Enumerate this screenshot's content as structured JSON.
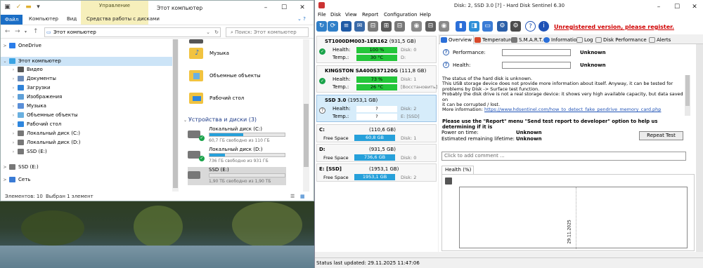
{
  "explorer": {
    "title": "Этот компьютер",
    "context_tab_top": "Управление",
    "ribbon_tabs": [
      "Файл",
      "Компьютер",
      "Вид",
      "Средства работы с дисками"
    ],
    "address": "Этот компьютер",
    "search_placeholder": "Поиск: Этот компьютер",
    "nav_items": [
      {
        "label": "OneDrive",
        "icon": "cloud-icon",
        "color": "#2b7de9"
      },
      {
        "label": "Этот компьютер",
        "icon": "computer-icon",
        "color": "#3aa3e3"
      },
      {
        "label": "Видео",
        "icon": "video-folder-icon",
        "color": "#555"
      },
      {
        "label": "Документы",
        "icon": "documents-folder-icon",
        "color": "#6b8bb8"
      },
      {
        "label": "Загрузки",
        "icon": "downloads-folder-icon",
        "color": "#2f82d8"
      },
      {
        "label": "Изображения",
        "icon": "pictures-folder-icon",
        "color": "#5fa0d8"
      },
      {
        "label": "Музыка",
        "icon": "music-folder-icon",
        "color": "#5a8fd8"
      },
      {
        "label": "Объемные объекты",
        "icon": "3d-objects-icon",
        "color": "#6ab0e0"
      },
      {
        "label": "Рабочий стол",
        "icon": "desktop-folder-icon",
        "color": "#2e86de"
      },
      {
        "label": "Локальный диск (C:)",
        "icon": "drive-icon",
        "color": "#777"
      },
      {
        "label": "Локальный диск (D:)",
        "icon": "drive-icon",
        "color": "#777"
      },
      {
        "label": "SSD (E:)",
        "icon": "drive-icon",
        "color": "#777"
      },
      {
        "label": "SSD (E:)",
        "icon": "drive-icon",
        "color": "#777"
      },
      {
        "label": "Сеть",
        "icon": "network-icon",
        "color": "#3a7bd5"
      }
    ],
    "folders": [
      "Музыка",
      "Объемные объекты",
      "Рабочий стол"
    ],
    "devices_header": "Устройства и диски (3)",
    "drives": [
      {
        "name": "Локальный диск (C:)",
        "free": "60,7 ГБ свободно из 110 ГБ",
        "used": 0.45
      },
      {
        "name": "Локальный диск (D:)",
        "free": "736 ГБ свободно из 931 ГБ",
        "used": 0.21
      },
      {
        "name": "SSD (E:)",
        "free": "1,90 ТБ свободно из 1,90 ТБ",
        "used": 0.0
      }
    ],
    "status": {
      "count": "Элементов: 10",
      "selected": "Выбран 1 элемент"
    }
  },
  "hds": {
    "title": "Disk: 2, SSD 3.0 [?]  -  Hard Disk Sentinel 6.30",
    "menu": [
      "File",
      "Disk",
      "View",
      "Report",
      "Configuration",
      "Help"
    ],
    "unregistered": "Unregistered version, please register.",
    "disks": [
      {
        "name": "ST1000DM003-1ER162",
        "size": "(931,5 GB)",
        "health": "100 %",
        "health_note": "Disk: 0",
        "temp": "30 °C",
        "temp_note": "D:",
        "color": "#24c63a",
        "status": "ok"
      },
      {
        "name": "KINGSTON SA400S37120G",
        "size": "(111,8 GB)",
        "health": "73 %",
        "health_note": "Disk: 1",
        "temp": "26 °C",
        "temp_note": "[Восстановить]",
        "color": "#24c63a",
        "status": "ok"
      },
      {
        "name": "SSD 3.0",
        "size": "(1953,1 GB)",
        "health": "?",
        "health_note": "Disk: 2",
        "temp": "?",
        "temp_note": "E: [SSD]",
        "color": "#ffffff",
        "status": "unknown"
      }
    ],
    "health_label": "Health:",
    "temp_label": "Temp.:",
    "free_space_label": "Free Space",
    "volumes": [
      {
        "name": "C:",
        "size": "(110,6 GB)",
        "free": "60,8 GB",
        "disk": "Disk: 1"
      },
      {
        "name": "D:",
        "size": "(931,5 GB)",
        "free": "736,6 GB",
        "disk": "Disk: 0"
      },
      {
        "name": "E: [SSD]",
        "size": "(1953,1 GB)",
        "free": "1953,1 GB",
        "disk": "Disk: 2"
      }
    ],
    "tabs": [
      "Overview",
      "Temperature",
      "S.M.A.R.T.",
      "Information",
      "Log",
      "Disk Performance",
      "Alerts"
    ],
    "performance_label": "Performance:",
    "performance_value": "Unknown",
    "health_field_label": "Health:",
    "health_value": "Unknown",
    "status_lines": [
      "The status of the hard disk is unknown.",
      "This USB storage device does not provide more information about itself. Anyway, it can be tested for",
      "problems by Disk -> Surface test function.",
      "Probably the disk drive is not a real storage device: it shows very high available capacity, but data saved on",
      "it can be corrupted / lost."
    ],
    "more_info_label": "More information:",
    "more_info_link": "https://www.hdsentinel.com/how_to_detect_fake_pendrive_memory_card.php",
    "warning": "Please use the \"Report\" menu \"Send test report to developer\" option to help us determining if it is",
    "power_on_label": "Power on time:",
    "power_on_value": "Unknown",
    "lifetime_label": "Estimated remaining lifetime:",
    "lifetime_value": "Unknown",
    "repeat_button": "Repeat Test",
    "comment_placeholder": "Click to add comment ...",
    "health_tab": "Health (%)",
    "chart_date": "29.11.2025",
    "status_bar": "Status last updated: 29.11.2025 11:47:06"
  }
}
